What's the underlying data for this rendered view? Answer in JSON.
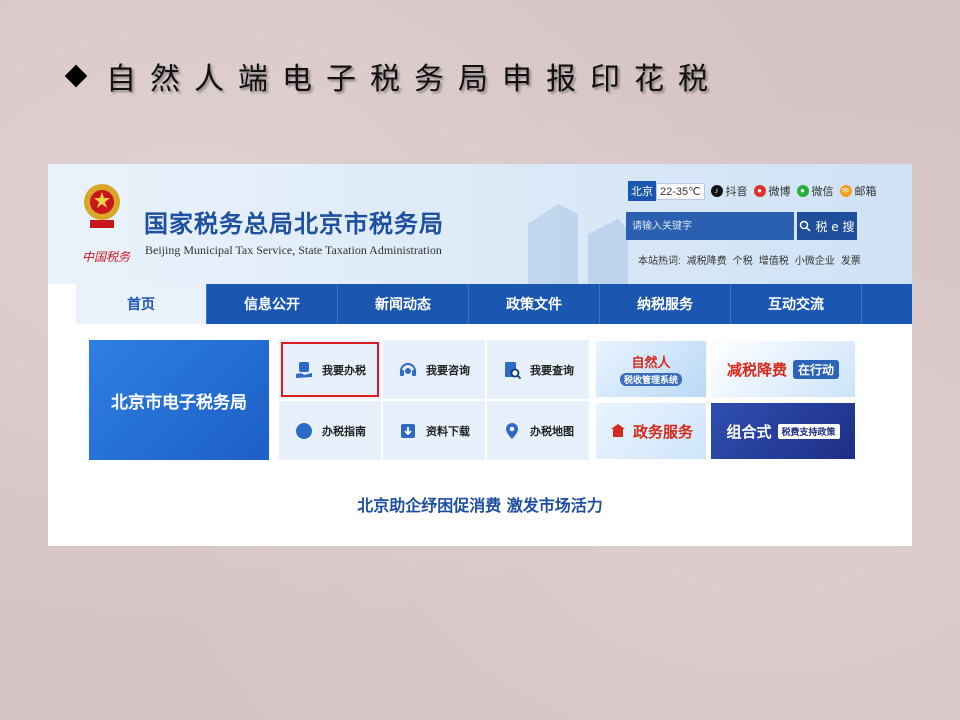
{
  "slide": {
    "title": "自然人端电子税务局申报印花税"
  },
  "site": {
    "title": "国家税务总局北京市税务局",
    "subtitle": "Beijing Municipal Tax Service, State Taxation Administration",
    "slogan": "中国税务",
    "city": "北京",
    "weather": "22-35℃",
    "social": [
      {
        "label": "抖音",
        "color": "#111111"
      },
      {
        "label": "微博",
        "color": "#e0302b"
      },
      {
        "label": "微信",
        "color": "#2aae3a"
      },
      {
        "label": "邮箱",
        "color": "#f0a020"
      }
    ],
    "search_placeholder": "请输入关键字",
    "search_button": "税 e 搜",
    "hot_label": "本站热词:",
    "hot_words": [
      "减税降费",
      "个税",
      "增值税",
      "小微企业",
      "发票"
    ]
  },
  "nav": {
    "items": [
      "首页",
      "信息公开",
      "新闻动态",
      "政策文件",
      "纳税服务",
      "互动交流"
    ],
    "active": "首页"
  },
  "main": {
    "banner": "北京市电子税务局",
    "tiles": [
      {
        "label": "我要办税",
        "icon": "hand-document-icon"
      },
      {
        "label": "我要咨询",
        "icon": "headset-icon"
      },
      {
        "label": "我要查询",
        "icon": "search-document-icon"
      },
      {
        "label": "办税指南",
        "icon": "compass-icon"
      },
      {
        "label": "资料下载",
        "icon": "download-icon"
      },
      {
        "label": "办税地图",
        "icon": "map-pin-icon"
      }
    ],
    "promos": {
      "natural_person": "自然人",
      "natural_person_sub": "税收管理系统",
      "tax_cut": "减税降费",
      "tax_cut_badge": "在行动",
      "gov_service": "政务服务",
      "combo": "组合式",
      "combo_badge": "税费支持政策"
    },
    "headline": "北京助企纾困促消费 激发市场活力"
  },
  "colors": {
    "accent": "#1b57b0",
    "highlight": "#d81e1e"
  }
}
